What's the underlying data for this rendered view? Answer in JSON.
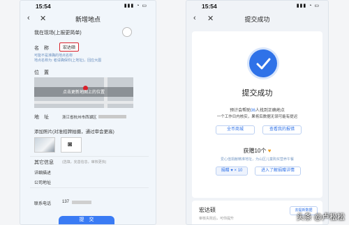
{
  "left": {
    "status_time": "15:54",
    "status_icons": "▮▮▮ ◔ ▭",
    "title": "新增地点",
    "owner_label": "我在现场(上报更简单)",
    "name_label": "名　称",
    "name_value": "宏达硕",
    "hint1": "可能不是准确的地点名称",
    "hint2": "地点名称为: 者请确保你(上地址)，回应大图",
    "location_label": "位　置",
    "map_overlay_text": "点击更新地图上的位置",
    "map_place": "",
    "address_label": "地　址",
    "address_value": "浙江省杭州市西湖区",
    "photo_label": "添加照片(对准招牌拍摄，通过审会更高)",
    "other_label": "其它信息",
    "other_hint": "(选填，完善信息，审核更快)",
    "detail_label": "详细描述",
    "company_label": "公司地址",
    "contact_label": "联系电话",
    "contact_value": "137",
    "submit": "提　交"
  },
  "right": {
    "status_time": "15:54",
    "status_icons": "▮▮▮ ◔ ▭",
    "nav_title": "提交成功",
    "result_title": "提交成功",
    "desc1_a": "预计会帮助",
    "desc1_num": "36",
    "desc1_b": "人找到正确地点",
    "desc2": "一个工作日内核实，果将后数据无误可能有提迟",
    "btn_left": "全币商城",
    "btn_right": "查看我的报错",
    "reward": "获赠10个",
    "reward_note": "爱心值捐献精准地址，为山区儿童购买营养午餐",
    "badge": "捐赠 ♥ × 10",
    "enter_btn": "进入了解捐赠详情",
    "bottom_title": "宏达硕",
    "bottom_sub": "审核失败后，可你提升",
    "bottom_btn": "去提新数据"
  },
  "watermark": "头条 @卢松松",
  "colors": {
    "accent": "#2f72e8",
    "highlight": "#d9212b",
    "gold": "#f0a020"
  }
}
